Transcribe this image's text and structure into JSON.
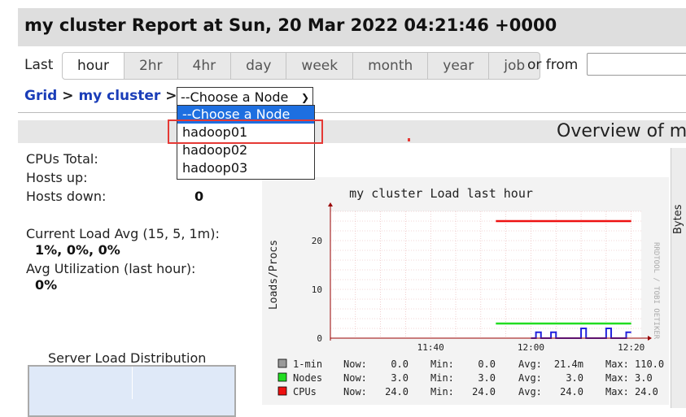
{
  "header": {
    "title": "my cluster Report at Sun, 20 Mar 2022 04:21:46 +0000"
  },
  "range": {
    "last_label": "Last",
    "tabs": [
      "hour",
      "2hr",
      "4hr",
      "day",
      "week",
      "month",
      "year",
      "job"
    ],
    "selected": "hour",
    "or_from_label": "or from",
    "from_value": ""
  },
  "breadcrumb": {
    "grid": "Grid",
    "sep": ">",
    "cluster": "my cluster"
  },
  "node_select": {
    "value": "--Choose a Node",
    "options": [
      "--Choose a Node",
      "hadoop01",
      "hadoop02",
      "hadoop03"
    ],
    "highlighted_option": "--Choose a Node"
  },
  "overview": {
    "title": "Overview of m"
  },
  "stats": {
    "cpus_label": "CPUs Total:",
    "hosts_up_label": "Hosts up:",
    "hosts_down_label": "Hosts down:",
    "hosts_down_value": "0",
    "load_label": "Current Load Avg (15, 5, 1m):",
    "load_value": "1%, 0%, 0%",
    "util_label": "Avg Utilization (last hour):",
    "util_value": "0%"
  },
  "distribution": {
    "title": "Server Load Distribution"
  },
  "right_panel": {
    "axis_label": "Bytes"
  },
  "chart_data": {
    "type": "line",
    "title": "my cluster Load last hour",
    "ylabel": "Loads/Procs",
    "watermark": "RRDTOOL / TOBI OETIKER",
    "x_ticks": [
      "11:40",
      "12:00",
      "12:20"
    ],
    "y_ticks": [
      0,
      10,
      20
    ],
    "ylim": [
      0,
      26
    ],
    "colors": {
      "load": "#2222dd",
      "nodes": "#22dd22",
      "cpus": "#ee1111",
      "grid": "#e8b0b0",
      "axis": "#990000"
    },
    "series": [
      {
        "name": "CPUs",
        "from": "11:53",
        "to": "12:20",
        "value": 24.0
      },
      {
        "name": "Nodes",
        "from": "11:53",
        "to": "12:20",
        "value": 3.0
      },
      {
        "name": "1-min",
        "points": [
          [
            "12:00",
            0
          ],
          [
            "12:01",
            0
          ],
          [
            "12:01",
            1.2
          ],
          [
            "12:02",
            1.2
          ],
          [
            "12:02",
            0
          ],
          [
            "12:04",
            0
          ],
          [
            "12:04",
            1.2
          ],
          [
            "12:05",
            1.2
          ],
          [
            "12:05",
            0
          ],
          [
            "12:10",
            0
          ],
          [
            "12:10",
            2.0
          ],
          [
            "12:11",
            2.0
          ],
          [
            "12:11",
            0
          ],
          [
            "12:15",
            0
          ],
          [
            "12:15",
            2.0
          ],
          [
            "12:16",
            2.0
          ],
          [
            "12:16",
            0
          ],
          [
            "12:19",
            0
          ],
          [
            "12:19",
            1.2
          ],
          [
            "12:20",
            1.2
          ]
        ]
      }
    ],
    "legend": [
      {
        "name": "1-min",
        "now": "0.0",
        "min": "0.0",
        "avg": "21.4m",
        "max": "110.0"
      },
      {
        "name": "Nodes",
        "now": "3.0",
        "min": "3.0",
        "avg": "3.0",
        "max": "3.0"
      },
      {
        "name": "CPUs",
        "now": "24.0",
        "min": "24.0",
        "avg": "24.0",
        "max": "24.0"
      }
    ],
    "legend_labels": {
      "now": "Now:",
      "min": "Min:",
      "avg": "Avg:",
      "max": "Max:"
    }
  }
}
